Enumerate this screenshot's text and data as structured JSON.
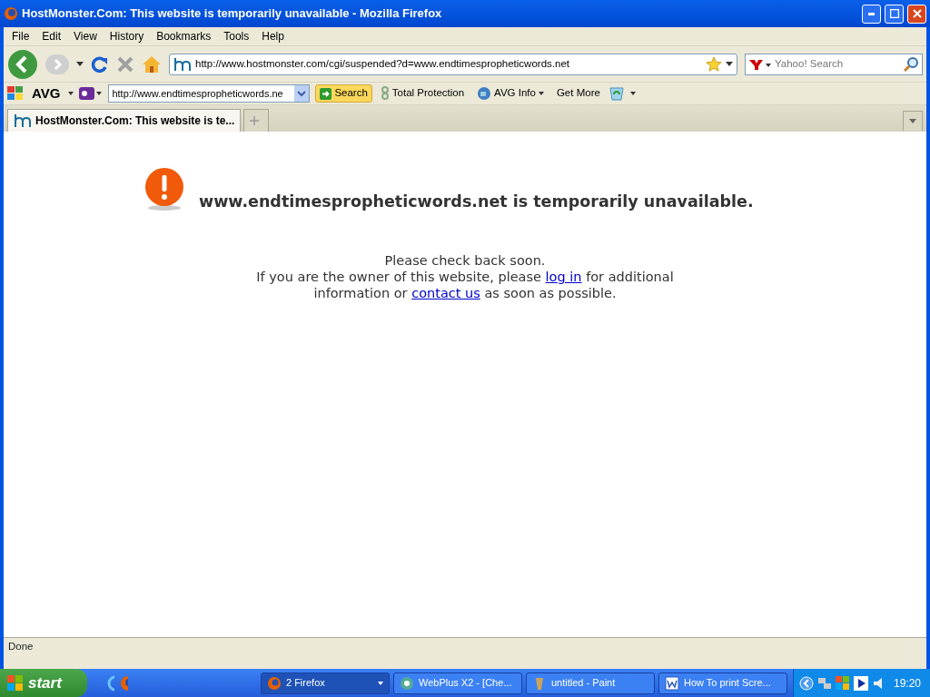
{
  "window": {
    "title": "HostMonster.Com: This website is temporarily unavailable - Mozilla Firefox"
  },
  "menu": [
    "File",
    "Edit",
    "View",
    "History",
    "Bookmarks",
    "Tools",
    "Help"
  ],
  "navigation": {
    "url": "http://www.hostmonster.com/cgi/suspended?d=www.endtimespropheticwords.net",
    "search_placeholder": "Yahoo! Search"
  },
  "avg_toolbar": {
    "brand": "AVG",
    "search_value": "http://www.endtimespropheticwords.ne",
    "search_button": "Search",
    "items": [
      "Total Protection",
      "AVG Info",
      "Get More"
    ]
  },
  "tabs": [
    {
      "label": "HostMonster.Com: This website is te...",
      "selected": true
    }
  ],
  "page": {
    "heading": "www.endtimespropheticwords.net is temporarily unavailable.",
    "first_line": "Please check back soon.",
    "message": [
      {
        "kind": "text",
        "text": "If you are the owner of this website, please "
      },
      {
        "kind": "link",
        "text": "log in"
      },
      {
        "kind": "text",
        "text": " for additional information or "
      },
      {
        "kind": "link",
        "text": "contact us"
      },
      {
        "kind": "text",
        "text": " as soon as possible."
      }
    ]
  },
  "status_bar": {
    "text": "Done"
  },
  "taskbar": {
    "start": "start",
    "tasks": [
      {
        "label": "2 Firefox",
        "selected": true
      },
      {
        "label": "WebPlus X2 - [Che...",
        "selected": false
      },
      {
        "label": "untitled - Paint",
        "selected": false
      },
      {
        "label": "How To print Scre...",
        "selected": false
      }
    ],
    "clock": "19:20"
  }
}
